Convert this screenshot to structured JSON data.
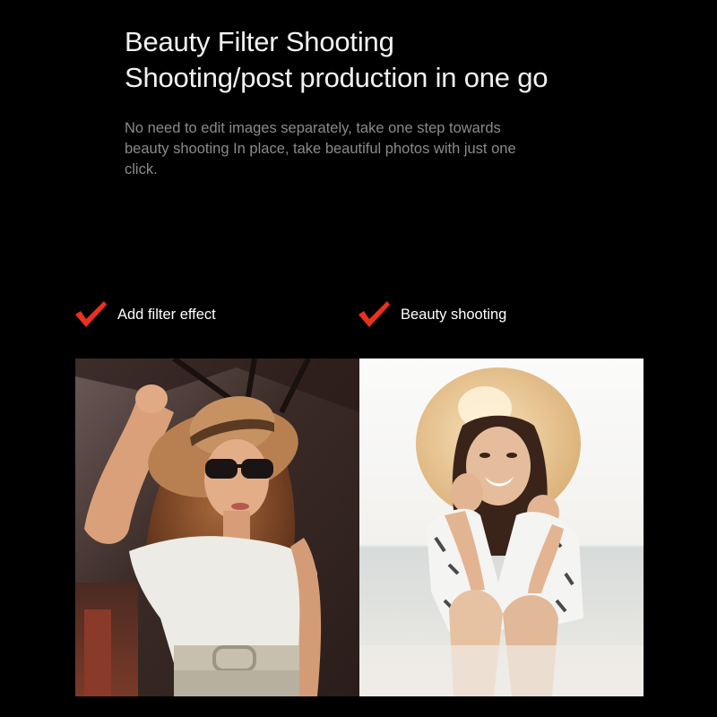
{
  "hero": {
    "title_line1": "Beauty Filter Shooting",
    "title_line2": "Shooting/post production in one go",
    "description": "No need to edit images separately, take one step towards beauty shooting In place, take beautiful photos with just one click."
  },
  "features": [
    {
      "label": "Add filter effect",
      "icon": "check-icon"
    },
    {
      "label": "Beauty shooting",
      "icon": "check-icon"
    }
  ],
  "colors": {
    "background": "#000000",
    "title": "#f2f2f2",
    "description": "#8a8a8a",
    "check_accent": "#e8321e"
  },
  "photos": [
    {
      "variant": "filter",
      "icon": "photo-woman-sunglasses-straw-hat"
    },
    {
      "variant": "beauty",
      "icon": "photo-woman-smiling-beach-straw-hat"
    }
  ]
}
